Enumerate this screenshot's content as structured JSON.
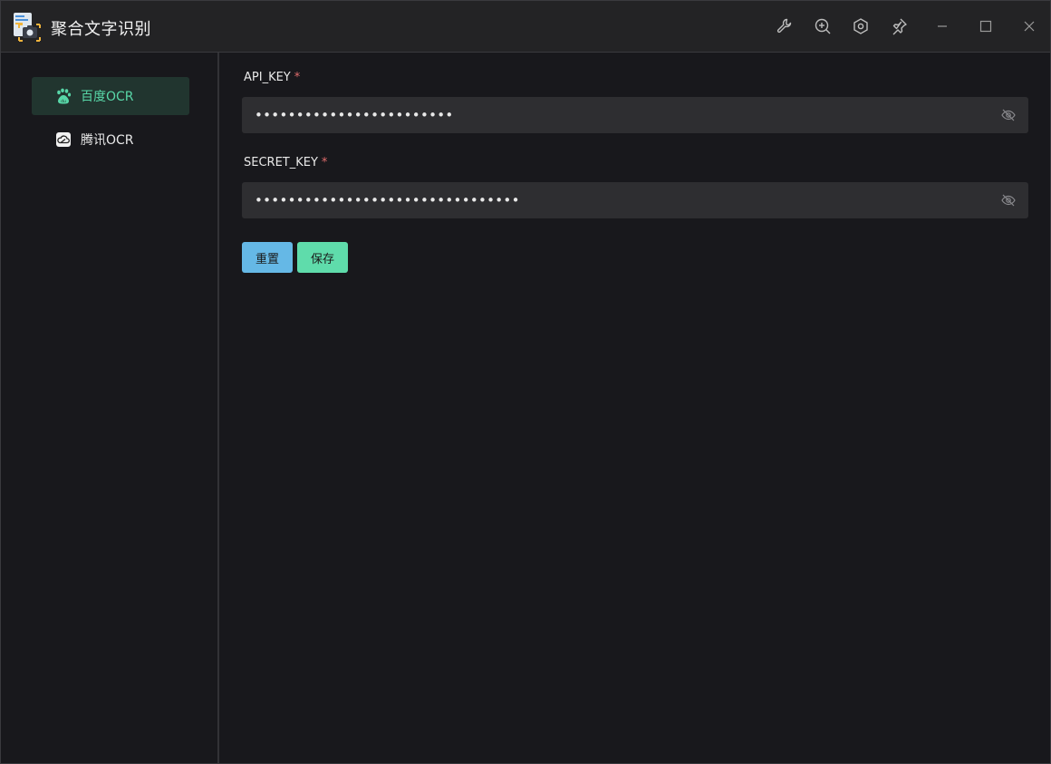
{
  "window": {
    "title": "聚合文字识别",
    "titlebar_icons": [
      "wrench-icon",
      "zoom-in-icon",
      "settings-hex-icon",
      "pin-icon",
      "minimize-icon",
      "maximize-icon",
      "close-icon"
    ]
  },
  "sidebar": {
    "items": [
      {
        "label": "百度OCR",
        "icon": "baidu-paw-icon",
        "active": true
      },
      {
        "label": "腾讯OCR",
        "icon": "tencent-cloud-icon",
        "active": false
      }
    ]
  },
  "form": {
    "api_key": {
      "label": "API_KEY",
      "required_mark": "*",
      "value": "••••••••••••••••••••••••"
    },
    "secret_key": {
      "label": "SECRET_KEY",
      "required_mark": "*",
      "value": "••••••••••••••••••••••••••••••••"
    }
  },
  "buttons": {
    "reset_label": "重置",
    "save_label": "保存"
  },
  "colors": {
    "accent_green": "#58d7a8",
    "reset_button": "#65b8e6",
    "save_button": "#5fdcab",
    "required": "#e06c6c"
  }
}
